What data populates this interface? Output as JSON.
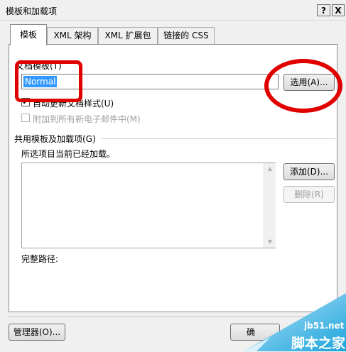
{
  "window": {
    "title": "模板和加载项",
    "help_button": "?",
    "close_button": "X"
  },
  "tabs": [
    {
      "label": "模板"
    },
    {
      "label": "XML 架构"
    },
    {
      "label": "XML 扩展包"
    },
    {
      "label": "链接的 CSS"
    }
  ],
  "document_template": {
    "label": "文档模板(T)",
    "value": "Normal",
    "select_button": "选用(A)..."
  },
  "options": {
    "auto_update": {
      "label": "自动更新文档样式(U)",
      "checked": true
    },
    "attach_email": {
      "label": "附加到所有新电子邮件中(M)",
      "checked": false,
      "enabled": false
    }
  },
  "global_templates": {
    "group_label": "共用模板及加载项(G)",
    "info_text": "所选项目当前已经加载。",
    "add_button": "添加(D)...",
    "remove_button": "删除(R)",
    "full_path_label": "完整路径:"
  },
  "footer": {
    "organizer_button": "管理器(O)...",
    "ok_button_partial": "确"
  },
  "watermark": {
    "domain": "jb51.net",
    "site_name": "脚本之家"
  },
  "annotation_color": "#e00000",
  "selection_color": "#3399ff"
}
